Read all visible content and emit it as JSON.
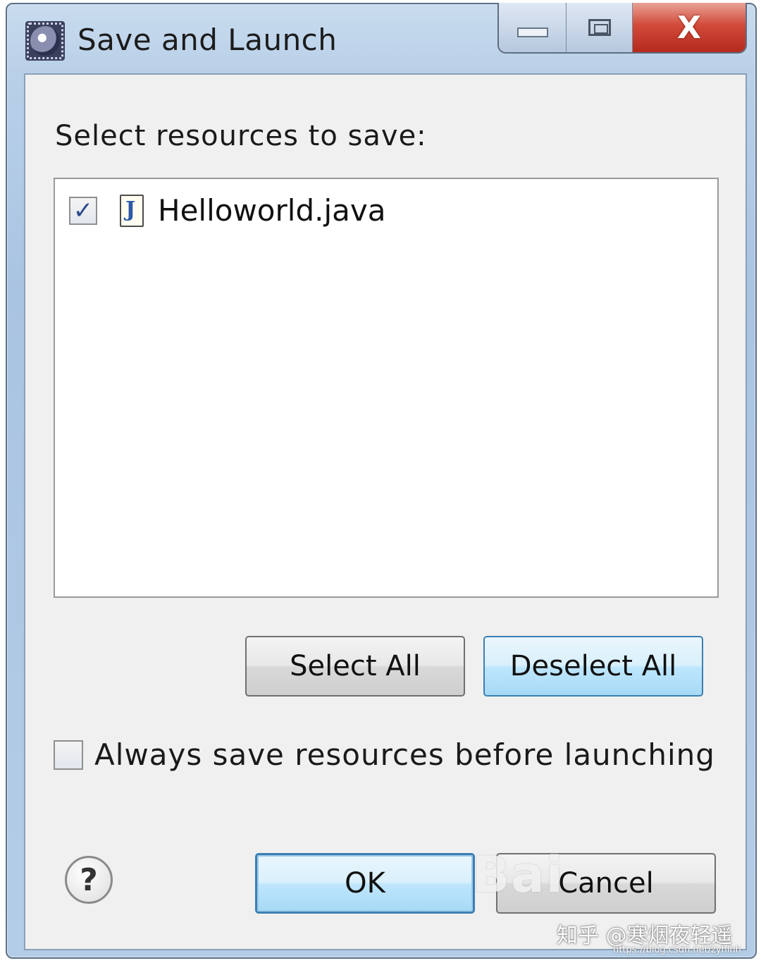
{
  "window": {
    "title": "Save and Launch",
    "app_icon": "eclipse-icon",
    "controls": {
      "minimize_icon": "minimize-icon",
      "maximize_icon": "maximize-icon",
      "close_icon": "close-icon",
      "close_glyph": "X"
    }
  },
  "dialog": {
    "section_label": "Select resources to save:",
    "resources": [
      {
        "name": "Helloworld.java",
        "checked": true,
        "icon": "java-file-icon",
        "check_glyph": "✓"
      }
    ],
    "select_all_label": "Select All",
    "deselect_all_label": "Deselect All",
    "always_save_label": "Always save resources before launching",
    "always_save_checked": false,
    "help_glyph": "?",
    "ok_label": "OK",
    "cancel_label": "Cancel"
  },
  "watermarks": {
    "baidu": "Bai",
    "zhihu": "知乎 @寒烟夜轻遥",
    "url": "https://blog.csdn.net/zyhlhh"
  },
  "colors": {
    "title_bar": "#b9d0e8",
    "close_button": "#d24a3a",
    "focus_button_border": "#3c7fb1",
    "dialog_background": "#f0f0f0"
  }
}
